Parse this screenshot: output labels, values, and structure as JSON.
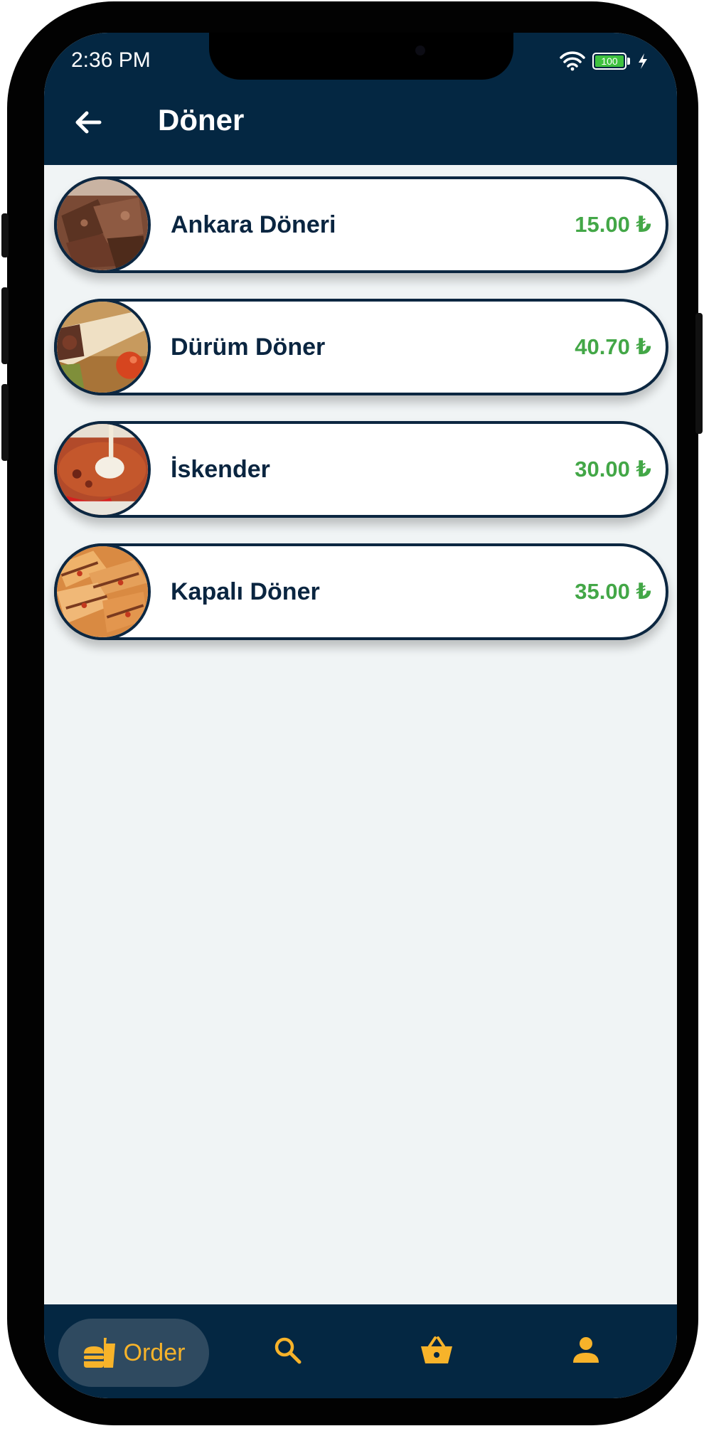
{
  "status_bar": {
    "time": "2:36 PM",
    "battery": "100",
    "icons": [
      "wifi-icon",
      "battery-icon",
      "charging-bolt-icon"
    ]
  },
  "app_bar": {
    "title": "Döner",
    "back_icon": "arrow-left-icon"
  },
  "products": [
    {
      "name": "Ankara Döneri",
      "price": "15.00 ₺",
      "image": "doner-meat-plate"
    },
    {
      "name": "Dürüm Döner",
      "price": "40.70 ₺",
      "image": "durum-wrap"
    },
    {
      "name": "İskender",
      "price": "30.00 ₺",
      "image": "iskender-plate"
    },
    {
      "name": "Kapalı Döner",
      "price": "35.00 ₺",
      "image": "kapali-doner-slices"
    }
  ],
  "bottom_nav": {
    "items": [
      {
        "label": "Order",
        "icon": "burger-drink-icon",
        "active": true
      },
      {
        "label": "",
        "icon": "search-icon",
        "active": false
      },
      {
        "label": "",
        "icon": "basket-icon",
        "active": false
      },
      {
        "label": "",
        "icon": "person-icon",
        "active": false
      }
    ]
  },
  "colors": {
    "primary": "#042742",
    "background": "#f0f4f5",
    "price": "#43a747",
    "accent": "#f7b32a"
  }
}
